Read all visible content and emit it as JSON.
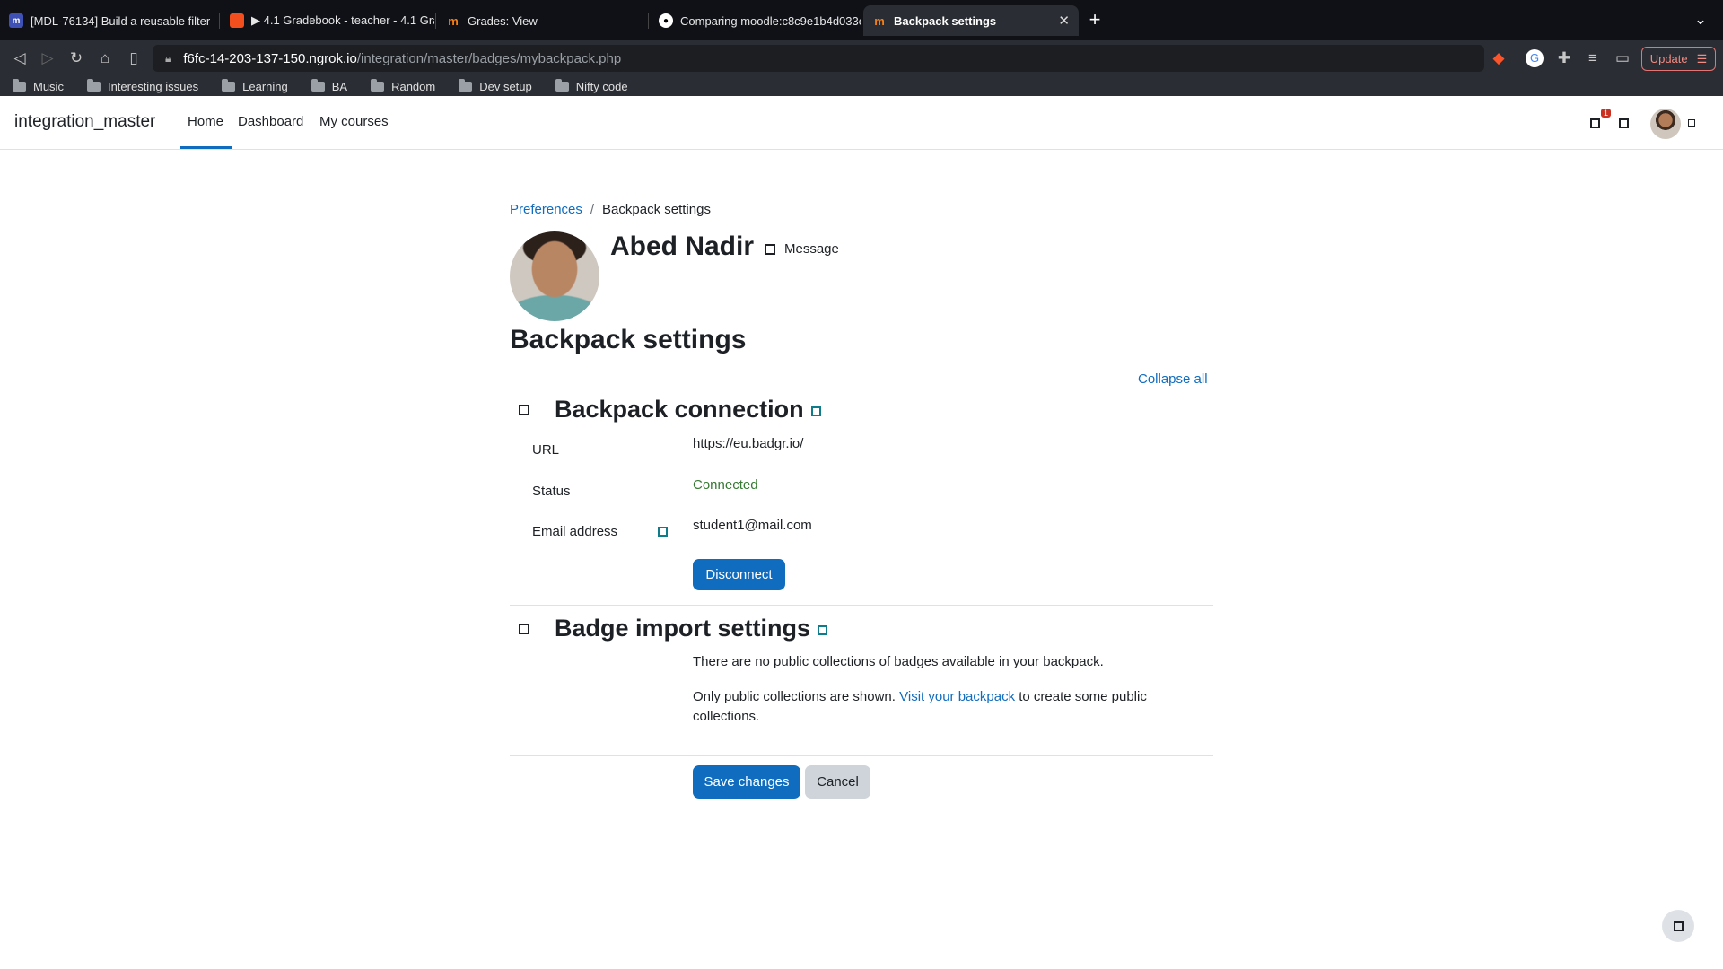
{
  "browser": {
    "tabs": [
      {
        "title": "[MDL-76134] Build a reusable filter",
        "icon": "jira-icon",
        "color": "#3f51b5"
      },
      {
        "title": "▶ 4.1 Gradebook - teacher - 4.1 Gra",
        "icon": "figma-icon",
        "color": "#f24e1e"
      },
      {
        "title": "Grades: View",
        "icon": "moodle-icon",
        "color": "#f98012"
      },
      {
        "title": "Comparing moodle:c8c9e1b4d033e",
        "icon": "github-icon",
        "color": "#ffffff"
      },
      {
        "title": "Backpack settings",
        "icon": "moodle-icon",
        "color": "#f98012"
      }
    ],
    "url_host": "f6fc-14-203-137-150.ngrok.io",
    "url_path": "/integration/master/badges/mybackpack.php",
    "update_label": "Update",
    "bookmarks": [
      "Music",
      "Interesting issues",
      "Learning",
      "BA",
      "Random",
      "Dev setup",
      "Nifty code"
    ]
  },
  "navbar": {
    "site_name": "integration_master",
    "links": [
      "Home",
      "Dashboard",
      "My courses"
    ],
    "notification_count": "1"
  },
  "page": {
    "breadcrumb": {
      "parent": "Preferences",
      "current": "Backpack settings"
    },
    "user_name": "Abed Nadir",
    "message_label": "Message",
    "heading": "Backpack settings",
    "collapse_all": "Collapse all",
    "connection": {
      "title": "Backpack connection",
      "url_label": "URL",
      "url_value": "https://eu.badgr.io/",
      "status_label": "Status",
      "status_value": "Connected",
      "email_label": "Email address",
      "email_value": "student1@mail.com",
      "disconnect_label": "Disconnect"
    },
    "import": {
      "title": "Badge import settings",
      "no_collections": "There are no public collections of badges available in your backpack.",
      "only_public_prefix": "Only public collections are shown.",
      "visit_link": "Visit your backpack",
      "only_public_suffix": "to create some public collections."
    },
    "save_label": "Save changes",
    "cancel_label": "Cancel"
  },
  "colors": {
    "accent": "#0f6cbf",
    "success": "#357a32",
    "help_icon": "#0f7c8c"
  }
}
